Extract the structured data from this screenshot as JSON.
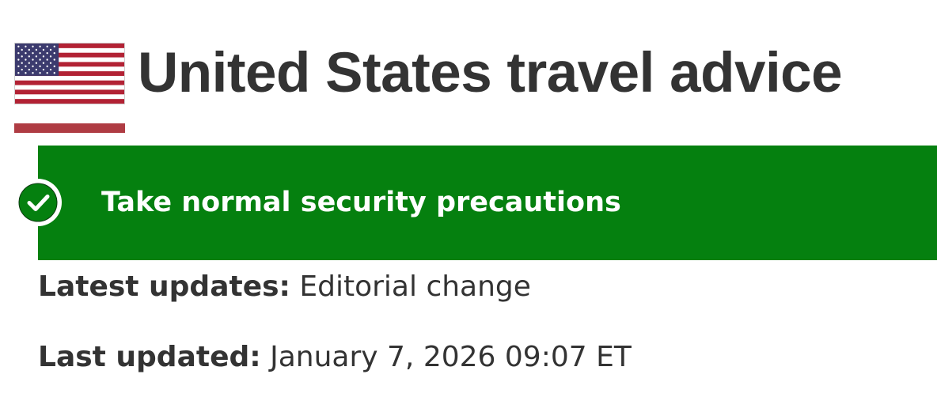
{
  "header": {
    "flag_icon": "us-flag-icon",
    "title": "United States travel advice",
    "accent_color": "#af3c43"
  },
  "advisory": {
    "level_text": "Take normal security precautions",
    "icon": "check-circle-icon",
    "color": "#05800f"
  },
  "meta": {
    "latest_updates_label": "Latest updates:",
    "latest_updates_value": "Editorial change",
    "last_updated_label": "Last updated:",
    "last_updated_value": "January 7, 2026 09:07 ET"
  }
}
